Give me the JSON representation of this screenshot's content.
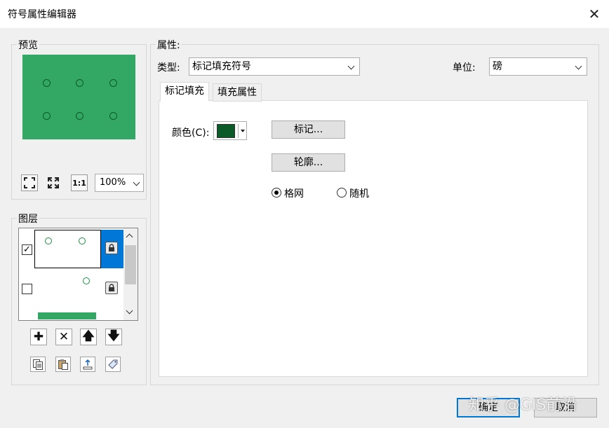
{
  "window": {
    "title": "符号属性编辑器",
    "close_icon": "close-icon"
  },
  "preview": {
    "label": "预览",
    "fill_color": "#33a864",
    "zoom": "100%",
    "toolbar": [
      "fit-all-icon",
      "expand-icon",
      "actual-size-icon"
    ],
    "actual_size_label": "1:1"
  },
  "layers": {
    "label": "图层",
    "items": [
      {
        "checked": true,
        "selected": true
      },
      {
        "checked": false,
        "selected": false
      }
    ],
    "check_mark": "✓",
    "buttons": [
      "add-icon",
      "remove-icon",
      "move-up-icon",
      "move-down-icon"
    ],
    "tools": [
      "copy-icon",
      "paste-icon",
      "import-icon",
      "tag-icon"
    ]
  },
  "properties": {
    "label": "属性:",
    "type_label": "类型:",
    "type_value": "标记填充符号",
    "unit_label": "单位:",
    "unit_value": "磅",
    "tabs": [
      {
        "label": "标记填充",
        "active": true
      },
      {
        "label": "填充属性",
        "active": false
      }
    ],
    "color_label": "颜色(C):",
    "color_value": "#0b5a28",
    "marker_button": "标记...",
    "outline_button": "轮廓...",
    "radio_options": [
      {
        "label": "格网",
        "selected": true
      },
      {
        "label": "随机",
        "selected": false
      }
    ]
  },
  "footer": {
    "ok_label": "确定",
    "cancel_label": "取消",
    "watermark": "知乎 @GIS前沿"
  }
}
